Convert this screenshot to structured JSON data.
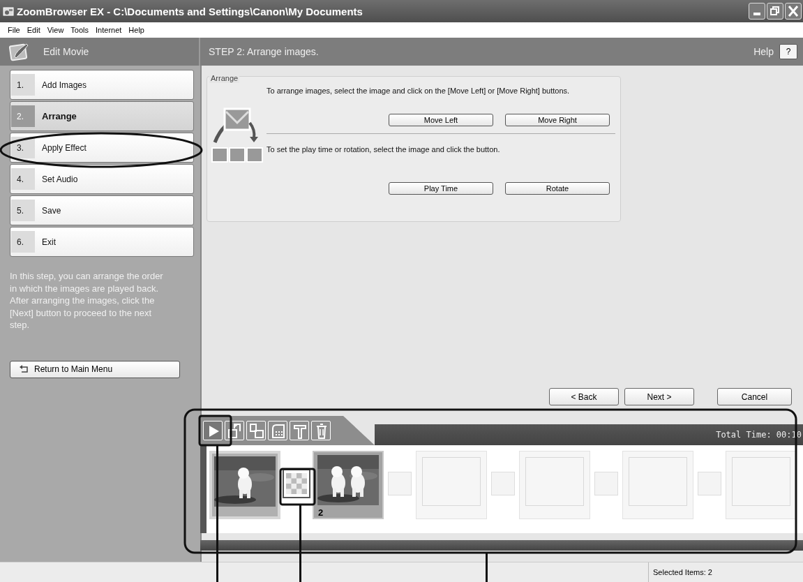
{
  "window": {
    "title": "ZoomBrowser EX  -  C:\\Documents and Settings\\Canon\\My Documents"
  },
  "menu": [
    "File",
    "Edit",
    "View",
    "Tools",
    "Internet",
    "Help"
  ],
  "header": {
    "section_title": "Edit Movie",
    "step_title": "STEP 2: Arrange images.",
    "help_label": "Help",
    "help_button": "?"
  },
  "steps": [
    {
      "number": "1.",
      "label": "Add Images",
      "selected": false
    },
    {
      "number": "2.",
      "label": "Arrange",
      "selected": true
    },
    {
      "number": "3.",
      "label": "Apply Effect",
      "selected": false
    },
    {
      "number": "4.",
      "label": "Set Audio",
      "selected": false
    },
    {
      "number": "5.",
      "label": "Save",
      "selected": false
    },
    {
      "number": "6.",
      "label": "Exit",
      "selected": false
    }
  ],
  "description": "In this step, you can arrange the order in which the images are played back.\n After arranging the images, click the [Next] button to proceed to the next step.",
  "return_button": "Return to Main Menu",
  "arrange": {
    "legend": "Arrange",
    "instruction_1": "To arrange images, select the image and click on the [Move Left] or [Move Right] buttons.",
    "buttons_1": [
      "Move Left",
      "Move Right"
    ],
    "instruction_2": "To set the play time or rotation, select the image and click the button.",
    "buttons_2": [
      "Play Time",
      "Rotate"
    ]
  },
  "nav_buttons": [
    "< Back",
    "Next >",
    "Cancel"
  ],
  "timeline": {
    "total_time": "Total Time: 00:10",
    "items": [
      {
        "kind": "clip",
        "selected": true
      },
      {
        "kind": "transition"
      },
      {
        "kind": "clip",
        "number": "2",
        "selected": false
      },
      {
        "kind": "empty_transition"
      },
      {
        "kind": "empty_slot"
      },
      {
        "kind": "empty_transition"
      },
      {
        "kind": "empty_slot"
      },
      {
        "kind": "empty_transition"
      },
      {
        "kind": "empty_slot"
      },
      {
        "kind": "empty_transition"
      },
      {
        "kind": "empty_slot"
      }
    ]
  },
  "status_bar": {
    "selection": "Selected Items: 2"
  }
}
